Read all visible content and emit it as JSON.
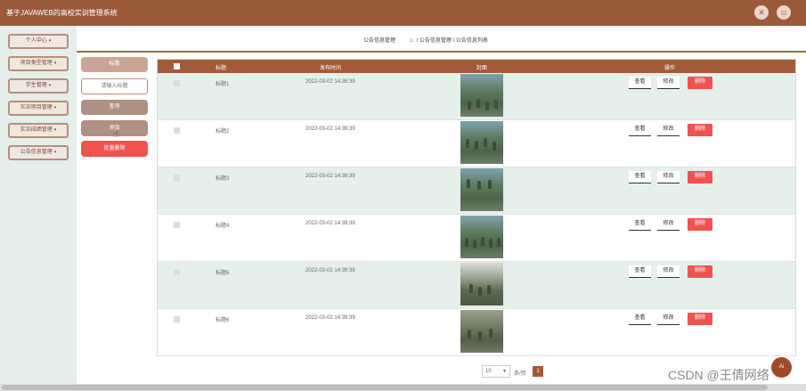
{
  "header": {
    "title": "基于JAVAWEB的高校实训管理系统",
    "fullscreen_icon": "fullscreen-icon",
    "user_icon": "user-icon"
  },
  "sidebar": {
    "items": [
      {
        "label": "个人中心"
      },
      {
        "label": "项目类型管理"
      },
      {
        "label": "学生管理"
      },
      {
        "label": "实训项目管理"
      },
      {
        "label": "实训成绩管理"
      },
      {
        "label": "公告信息管理"
      }
    ]
  },
  "breadcrumb": {
    "left": "公告信息管理",
    "path": "/ 公告信息管理 / 公告信息列表"
  },
  "search": {
    "label": "标题",
    "placeholder": "请输入标题"
  },
  "buttons": {
    "query": "查询",
    "add": "添加",
    "bulk_delete": "批量删除"
  },
  "table": {
    "columns": [
      "标题",
      "发布时间",
      "封面",
      "操作"
    ],
    "actions": {
      "view": "查看",
      "edit": "修改",
      "delete": "删除"
    },
    "rows": [
      {
        "title": "标题1",
        "time": "2022-03-02 14:39:39"
      },
      {
        "title": "标题2",
        "time": "2022-03-02 14:39:39"
      },
      {
        "title": "标题3",
        "time": "2022-03-02 14:39:39"
      },
      {
        "title": "标题4",
        "time": "2022-03-02 14:39:39"
      },
      {
        "title": "标题5",
        "time": "2022-03-02 14:39:39"
      },
      {
        "title": "标题6",
        "time": "2022-03-02 14:39:39"
      }
    ]
  },
  "pager": {
    "page_size": "10",
    "total_text": "条/页",
    "current_page": "1"
  },
  "fab": {
    "label": "Ai"
  },
  "watermark": "CSDN @王倩网络",
  "colors": {
    "brand": "#9b5a3a",
    "table_header": "#a25a3a",
    "danger": "#f0534f",
    "row_alt": "#e5f0eb"
  }
}
